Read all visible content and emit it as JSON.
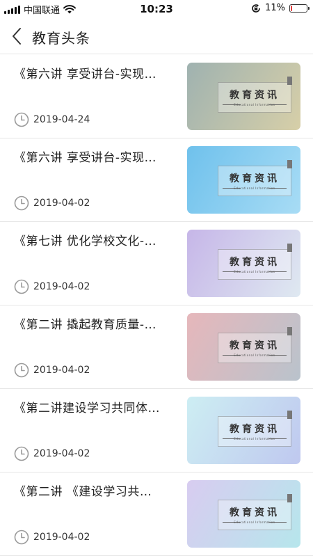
{
  "status_bar": {
    "carrier": "中国联通",
    "time": "10:23",
    "battery_percent": "11%",
    "battery_level": 0.11,
    "battery_color": "#e23b3b",
    "icons": [
      "signal-icon",
      "wifi-icon",
      "rotation-lock-icon",
      "battery-icon"
    ]
  },
  "nav": {
    "back_icon": "chevron-left-icon",
    "title": "教育头条"
  },
  "thumbnail": {
    "label": "教育资讯",
    "sub": "Educational Information"
  },
  "articles": [
    {
      "title": "《第六讲 享受讲台-实现…",
      "date": "2019-04-24",
      "thumb_colors": [
        "#9fb2b0",
        "#d7cfa8"
      ]
    },
    {
      "title": "《第六讲 享受讲台-实现…",
      "date": "2019-04-02",
      "thumb_colors": [
        "#6fc1ec",
        "#a8dcf5"
      ]
    },
    {
      "title": "《第七讲 优化学校文化-…",
      "date": "2019-04-02",
      "thumb_colors": [
        "#c6b6e8",
        "#dfe9f1"
      ]
    },
    {
      "title": "《第二讲 撬起教育质量-…",
      "date": "2019-04-02",
      "thumb_colors": [
        "#e6b7bb",
        "#b9c3cc"
      ]
    },
    {
      "title": "《第二讲建设学习共同体…",
      "date": "2019-04-02",
      "thumb_colors": [
        "#cdeef3",
        "#bfc8ef"
      ]
    },
    {
      "title": "《第二讲 《建设学习共…",
      "date": "2019-04-02",
      "thumb_colors": [
        "#d8ccf0",
        "#b6e6ec"
      ]
    }
  ]
}
